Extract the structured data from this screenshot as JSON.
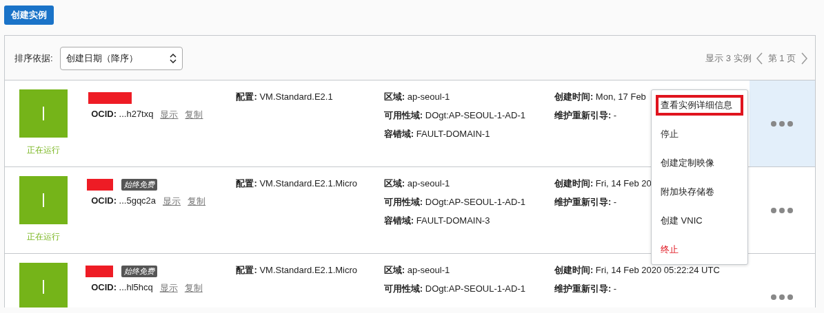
{
  "create_button": "创建实例",
  "toolbar": {
    "sort_label": "排序依据:",
    "sort_value": "创建日期（降序）",
    "count": "显示 3 实例",
    "page": "第 1 页"
  },
  "instances": [
    {
      "hovered": true,
      "status": "正在运行",
      "ocid_label": "OCID:",
      "ocid": "...h27txq",
      "show": "显示",
      "copy": "复制",
      "columns": [
        [
          {
            "label": "配置:",
            "value": "VM.Standard.E2.1"
          }
        ],
        [
          {
            "label": "区域:",
            "value": "ap-seoul-1"
          },
          {
            "label": "可用性域:",
            "value": "DOgt:AP-SEOUL-1-AD-1"
          },
          {
            "label": "容错域:",
            "value": "FAULT-DOMAIN-1"
          }
        ],
        [
          {
            "label": "创建时间:",
            "value": "Mon, 17 Feb"
          },
          {
            "label": "维护重新引导:",
            "value": "-"
          }
        ]
      ]
    },
    {
      "hovered": false,
      "status": "正在运行",
      "badge": "始终免费",
      "ocid_label": "OCID:",
      "ocid": "...5gqc2a",
      "show": "显示",
      "copy": "复制",
      "columns": [
        [
          {
            "label": "配置:",
            "value": "VM.Standard.E2.1.Micro"
          }
        ],
        [
          {
            "label": "区域:",
            "value": "ap-seoul-1"
          },
          {
            "label": "可用性域:",
            "value": "DOgt:AP-SEOUL-1-AD-1"
          },
          {
            "label": "容错域:",
            "value": "FAULT-DOMAIN-3"
          }
        ],
        [
          {
            "label": "创建时间:",
            "value": "Fri, 14 Feb 20"
          },
          {
            "label": "维护重新引导:",
            "value": "-"
          }
        ]
      ]
    },
    {
      "hovered": false,
      "badge": "始终免费",
      "ocid_label": "OCID:",
      "ocid": "...hl5hcq",
      "show": "显示",
      "copy": "复制",
      "columns": [
        [
          {
            "label": "配置:",
            "value": "VM.Standard.E2.1.Micro"
          }
        ],
        [
          {
            "label": "区域:",
            "value": "ap-seoul-1"
          },
          {
            "label": "可用性域:",
            "value": "DOgt:AP-SEOUL-1-AD-1"
          }
        ],
        [
          {
            "label": "创建时间:",
            "value": "Fri, 14 Feb 2020 05:22:24 UTC"
          },
          {
            "label": "维护重新引导:",
            "value": "-"
          }
        ]
      ]
    }
  ],
  "menu": [
    {
      "label": "查看实例详细信息",
      "kind": "normal",
      "highlighted": true
    },
    {
      "label": "停止",
      "kind": "normal",
      "highlighted": false
    },
    {
      "label": "创建定制映像",
      "kind": "normal",
      "highlighted": false
    },
    {
      "label": "附加块存储卷",
      "kind": "normal",
      "highlighted": false
    },
    {
      "label": "创建 VNIC",
      "kind": "normal",
      "highlighted": false
    },
    {
      "label": "终止",
      "kind": "danger",
      "highlighted": false
    }
  ]
}
